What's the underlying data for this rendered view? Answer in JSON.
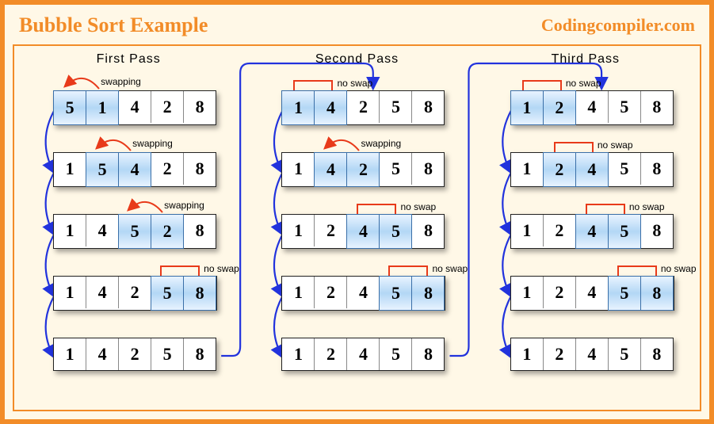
{
  "header": {
    "title": "Bubble Sort Example",
    "site": "Codingcompiler.com"
  },
  "labels": {
    "swap": "swapping",
    "noswap": "no swap"
  },
  "passes": [
    {
      "title": "First  Pass",
      "steps": [
        {
          "cells": [
            5,
            1,
            4,
            2,
            8
          ],
          "highlight": [
            0,
            1
          ],
          "label_type": "swap"
        },
        {
          "cells": [
            1,
            5,
            4,
            2,
            8
          ],
          "highlight": [
            1,
            2
          ],
          "label_type": "swap"
        },
        {
          "cells": [
            1,
            4,
            5,
            2,
            8
          ],
          "highlight": [
            2,
            3
          ],
          "label_type": "swap"
        },
        {
          "cells": [
            1,
            4,
            2,
            5,
            8
          ],
          "highlight": [
            3,
            4
          ],
          "label_type": "noswap"
        },
        {
          "cells": [
            1,
            4,
            2,
            5,
            8
          ],
          "highlight": [],
          "label_type": null
        }
      ]
    },
    {
      "title": "Second  Pass",
      "steps": [
        {
          "cells": [
            1,
            4,
            2,
            5,
            8
          ],
          "highlight": [
            0,
            1
          ],
          "label_type": "noswap"
        },
        {
          "cells": [
            1,
            4,
            2,
            5,
            8
          ],
          "highlight": [
            1,
            2
          ],
          "label_type": "swap"
        },
        {
          "cells": [
            1,
            2,
            4,
            5,
            8
          ],
          "highlight": [
            2,
            3
          ],
          "label_type": "noswap"
        },
        {
          "cells": [
            1,
            2,
            4,
            5,
            8
          ],
          "highlight": [
            3,
            4
          ],
          "label_type": "noswap"
        },
        {
          "cells": [
            1,
            2,
            4,
            5,
            8
          ],
          "highlight": [],
          "label_type": null
        }
      ]
    },
    {
      "title": "Third  Pass",
      "steps": [
        {
          "cells": [
            1,
            2,
            4,
            5,
            8
          ],
          "highlight": [
            0,
            1
          ],
          "label_type": "noswap"
        },
        {
          "cells": [
            1,
            2,
            4,
            5,
            8
          ],
          "highlight": [
            1,
            2
          ],
          "label_type": "noswap"
        },
        {
          "cells": [
            1,
            2,
            4,
            5,
            8
          ],
          "highlight": [
            2,
            3
          ],
          "label_type": "noswap"
        },
        {
          "cells": [
            1,
            2,
            4,
            5,
            8
          ],
          "highlight": [
            3,
            4
          ],
          "label_type": "noswap"
        },
        {
          "cells": [
            1,
            2,
            4,
            5,
            8
          ],
          "highlight": [],
          "label_type": null
        }
      ]
    }
  ],
  "colors": {
    "frame": "#F28C28",
    "highlight": "#b3d7f5",
    "flow_arrow": "#2233dd",
    "swap_arrow": "#e83a1a"
  }
}
